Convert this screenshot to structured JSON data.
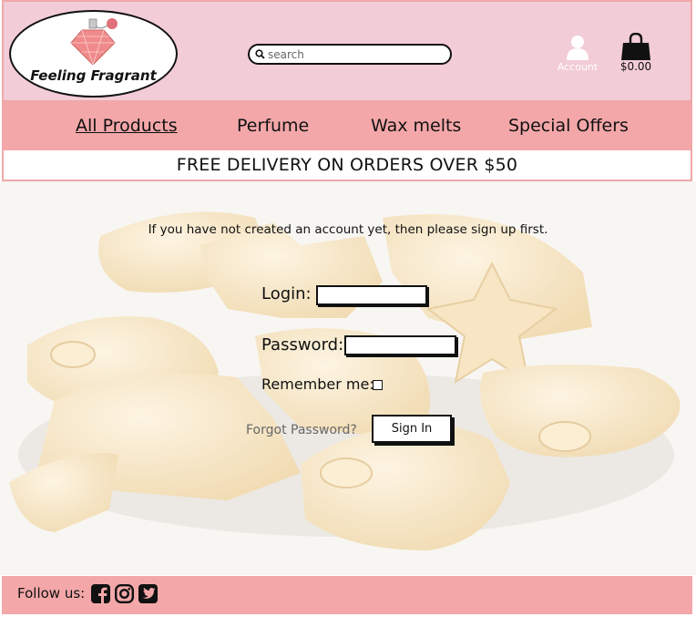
{
  "header": {
    "logo_text": "Feeling Fragrant",
    "search_placeholder": "search",
    "account_label": "Account",
    "cart_total": "$0.00"
  },
  "nav": {
    "items": [
      "All Products",
      "Perfume",
      "Wax melts",
      "Special Offers"
    ]
  },
  "banner": "FREE DELIVERY ON ORDERS OVER $50",
  "login": {
    "notice": "If you have not created an account yet, then please sign up first.",
    "login_label": "Login:",
    "password_label": "Password:",
    "remember_label": "Remember me:",
    "forgot_label": "Forgot Password?",
    "signin_label": "Sign In"
  },
  "footer": {
    "follow_label": "Follow us:",
    "social_icons": [
      "facebook-icon",
      "instagram-icon",
      "twitter-icon"
    ]
  },
  "colors": {
    "header_bg": "#f2ccd6",
    "nav_bg": "#f3a7a9",
    "melt": "#f6e3c0"
  }
}
